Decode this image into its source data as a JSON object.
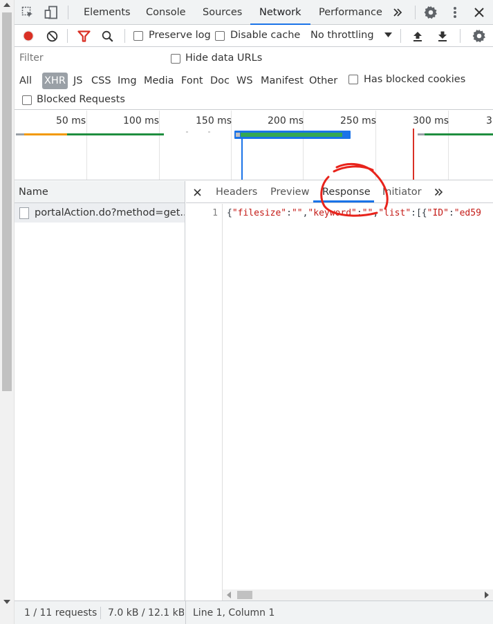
{
  "main_tabs": [
    "Elements",
    "Console",
    "Sources",
    "Network",
    "Performance"
  ],
  "active_main_tab": "Network",
  "toolbar": {
    "preserve_log": "Preserve log",
    "disable_cache": "Disable cache",
    "throttling": "No throttling"
  },
  "filter": {
    "placeholder": "Filter",
    "hide_data_urls": "Hide data URLs",
    "types": [
      "All",
      "XHR",
      "JS",
      "CSS",
      "Img",
      "Media",
      "Font",
      "Doc",
      "WS",
      "Manifest",
      "Other"
    ],
    "active_type": "XHR",
    "has_blocked_cookies": "Has blocked cookies",
    "blocked_requests": "Blocked Requests"
  },
  "overview": {
    "ticks": [
      "50 ms",
      "100 ms",
      "150 ms",
      "200 ms",
      "250 ms",
      "300 ms",
      "3"
    ]
  },
  "requests": {
    "header": "Name",
    "rows": [
      "portalAction.do?method=get..."
    ]
  },
  "detail": {
    "tabs": [
      "Headers",
      "Preview",
      "Response",
      "Initiator"
    ],
    "active_tab": "Response",
    "line_number": "1",
    "response_parts": {
      "p1": "{",
      "k1": "\"filesize\"",
      "p2": ":",
      "v1": "\"\"",
      "p3": ",",
      "k2": "\"keyword\"",
      "p4": ":",
      "v2": "\"\"",
      "p5": ",",
      "k3": "\"list\"",
      "p6": ":[{",
      "k4": "\"ID\"",
      "p7": ":",
      "v4": "\"ed59"
    }
  },
  "status": {
    "requests": "1 / 11 requests",
    "transferred": "7.0 kB / 12.1 kB t",
    "cursor": "Line 1, Column 1"
  },
  "colors": {
    "accent": "#1a73e8",
    "record": "#d93025",
    "filter_icon": "#d93025",
    "annotation": "#e8231b"
  }
}
